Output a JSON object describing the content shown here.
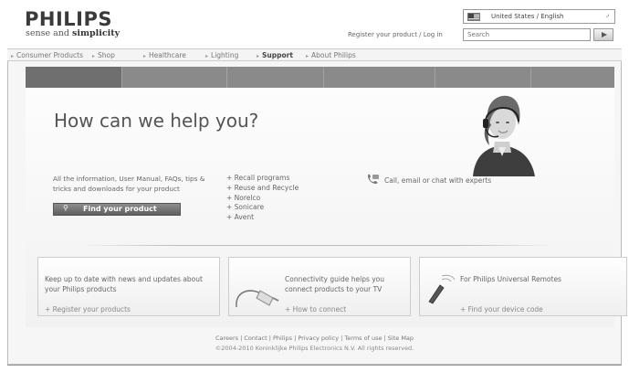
{
  "header": {
    "logo": "PHILIPS",
    "tagline_prefix": "sense and ",
    "tagline_bold": "simplicity",
    "locale": "United States / English",
    "register_link": "Register your product / Log in",
    "search_placeholder": "Search"
  },
  "nav": {
    "items": [
      {
        "label": "Consumer Products"
      },
      {
        "label": "Shop"
      },
      {
        "label": "Healthcare"
      },
      {
        "label": "Lighting"
      },
      {
        "label": "Support"
      },
      {
        "label": "About Philips"
      }
    ],
    "active_index": 4
  },
  "main": {
    "headline": "How can we help you?",
    "intro": "All the information, User Manual, FAQs, tips & tricks and downloads for your product",
    "find_button": "Find your product",
    "quick_links": [
      "Recall programs",
      "Reuse and Recycle",
      "Norelco",
      "Sonicare",
      "Avent"
    ],
    "contact": "Call, email or chat with experts"
  },
  "cards": [
    {
      "text": "Keep up to date with news and updates about your Philips products",
      "link": "Register your products",
      "icon": "none"
    },
    {
      "text": "Connectivity guide helps you connect products to your TV",
      "link": "How to connect",
      "icon": "cable-icon"
    },
    {
      "text": "For Philips Universal Remotes",
      "link": "Find your device code",
      "icon": "remote-icon"
    }
  ],
  "footer": {
    "links": [
      "Careers",
      "Contact",
      "Philips",
      "Privacy policy",
      "Terms of use",
      "Site Map"
    ],
    "separator": " | ",
    "copyright": "©2004-2010 Koninklijke Philips Electronics N.V. All rights reserved."
  },
  "icons": {
    "locale": "flag-icon",
    "search": "arrow-right-icon",
    "find": "magnifier-icon",
    "contact": "phone-icon"
  },
  "colors": {
    "tab_bar": "#8a8a8a",
    "button": "#6a6a6a"
  }
}
